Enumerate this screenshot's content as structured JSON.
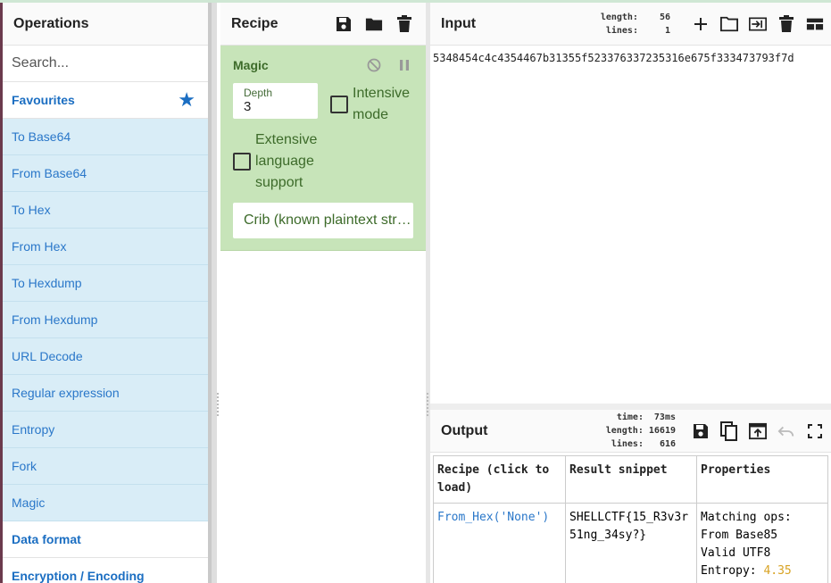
{
  "operations": {
    "title": "Operations",
    "search_placeholder": "Search...",
    "favourites_label": "Favourites",
    "items": [
      {
        "label": "To Base64"
      },
      {
        "label": "From Base64"
      },
      {
        "label": "To Hex"
      },
      {
        "label": "From Hex"
      },
      {
        "label": "To Hexdump"
      },
      {
        "label": "From Hexdump"
      },
      {
        "label": "URL Decode"
      },
      {
        "label": "Regular expression"
      },
      {
        "label": "Entropy"
      },
      {
        "label": "Fork"
      },
      {
        "label": "Magic"
      }
    ],
    "categories": [
      {
        "label": "Data format"
      },
      {
        "label": "Encryption / Encoding"
      }
    ]
  },
  "recipe": {
    "title": "Recipe",
    "magic": {
      "title": "Magic",
      "depth_label": "Depth",
      "depth_value": "3",
      "intensive_label": "Intensive mode",
      "extensive_label": "Extensive language support",
      "crib_label": "Crib (known plaintext str…"
    }
  },
  "input": {
    "title": "Input",
    "length_label": "length:",
    "length_value": "56",
    "lines_label": "lines:",
    "lines_value": "1",
    "text": "5348454c4c4354467b31355f523376337235316e675f333473793f7d"
  },
  "output": {
    "title": "Output",
    "time_label": "time:",
    "time_value": "73ms",
    "length_label": "length:",
    "length_value": "16619",
    "lines_label": "lines:",
    "lines_value": "616",
    "table": {
      "headers": [
        "Recipe (click to load)",
        "Result snippet",
        "Properties"
      ],
      "row": {
        "recipe": "From_Hex('None')",
        "snippet": "SHELLCTF{15_R3v3r51ng_34sy?}",
        "prop_line1": "Matching ops:",
        "prop_line2": "From Base85",
        "prop_line3": "Valid UTF8",
        "entropy_label": "Entropy:",
        "entropy_value": "4.35"
      }
    }
  },
  "colors": {
    "accent_blue": "#1b6ec2",
    "magic_green": "#c7e4b9",
    "favourite_bg": "#d9edf7",
    "entropy_value": "#d8a324"
  }
}
